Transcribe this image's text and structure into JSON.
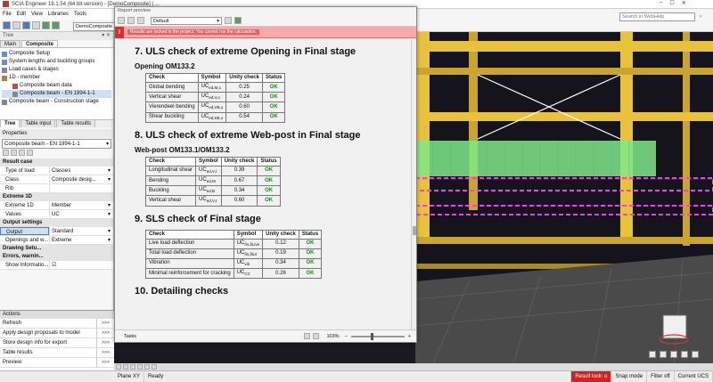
{
  "app": {
    "title": "SCIA Engineer 18.1.54 (64 bit version) - [DemoComposite] | ...",
    "menu": [
      "File",
      "Edit",
      "View",
      "Libraries",
      "Tools"
    ],
    "project_tab": "DemoComposite"
  },
  "search": {
    "placeholder": "Search in WebHelp"
  },
  "tree_panel": {
    "header": "Tree",
    "tabs": [
      "Main",
      "Composite"
    ],
    "items": [
      "Composite Setup",
      "System lengths and buckling groups",
      "Load cases & stages",
      "1D - member",
      "Composite beam data",
      "Composite beam - EN 1994-1-1",
      "Composite beam - Construction stage"
    ],
    "bottom_tabs": [
      "Tree",
      "Table input",
      "Table results"
    ]
  },
  "properties": {
    "header": "Properties",
    "selected": "Composite beam - EN 1994-1-1",
    "groups": [
      {
        "name": "Result case",
        "rows": [
          {
            "key": "Type of load",
            "value": "Classes"
          },
          {
            "key": "Class",
            "value": "Composite desig..."
          },
          {
            "key": "Rib",
            "value": ""
          }
        ]
      },
      {
        "name": "Extreme 1D",
        "rows": [
          {
            "key": "Extreme 1D",
            "value": "Member"
          },
          {
            "key": "Values",
            "value": "UC"
          }
        ]
      },
      {
        "name": "Output settings",
        "rows": [
          {
            "key": "Output",
            "value": "Standard"
          },
          {
            "key": "Openings and w...",
            "value": "Extreme"
          }
        ]
      },
      {
        "name": "Drawing Setu...",
        "rows": []
      },
      {
        "name": "Errors, warnin...",
        "rows": [
          {
            "key": "Show Informatio...",
            "value": ""
          }
        ]
      }
    ]
  },
  "actions": {
    "header": "Actions",
    "items": [
      "Refresh",
      "Apply design proposals to model",
      "Store design info for export",
      "Table results",
      "Preview"
    ],
    "button": ">>>"
  },
  "report": {
    "window_title": "Report preview",
    "style": "Default",
    "warning": "Results are locked in the project. You cannot run the calculation.",
    "sections": [
      {
        "title": "7. ULS check of extreme Opening in Final stage",
        "subtitle": "Opening OM133.2",
        "headers": [
          "Check",
          "Symbol",
          "Unity check",
          "Status"
        ],
        "rows": [
          [
            "Global bending",
            "UC",
            "ed,M,o",
            "0.25",
            "OK"
          ],
          [
            "Vertical shear",
            "UC",
            "ed,V,o",
            "0.24",
            "OK"
          ],
          [
            "Vierendeel bending",
            "UC",
            "ed,VB,o",
            "0.60",
            "OK"
          ],
          [
            "Shear buckling",
            "UC",
            "ed,SB,o",
            "0.54",
            "OK"
          ]
        ]
      },
      {
        "title": "8. ULS check of extreme Web-post in Final stage",
        "subtitle": "Web-post OM133.1/OM133.2",
        "headers": [
          "Check",
          "Symbol",
          "Unity check",
          "Status"
        ],
        "rows": [
          [
            "Longitudinal shear",
            "UC",
            "ed,V,l",
            "0.39",
            "OK"
          ],
          [
            "Bending",
            "UC",
            "ed,M",
            "0.67",
            "OK"
          ],
          [
            "Buckling",
            "UC",
            "ed,B",
            "0.34",
            "OK"
          ],
          [
            "Vertical shear",
            "UC",
            "ed,V,t",
            "0.60",
            "OK"
          ]
        ]
      },
      {
        "title": "9. SLS check of Final stage",
        "subtitle": "",
        "headers": [
          "Check",
          "Symbol",
          "Unity check",
          "Status"
        ],
        "rows": [
          [
            "Live load deflection",
            "UC",
            "fin,δLive",
            "0.12",
            "OK"
          ],
          [
            "Total load deflection",
            "UC",
            "fin,δtot",
            "0.19",
            "OK"
          ],
          [
            "Vibration",
            "UC",
            "vib",
            "0.34",
            "OK"
          ],
          [
            "Minimal reinforcement for cracking",
            "UC",
            "CC",
            "0.26",
            "OK"
          ]
        ]
      },
      {
        "title": "10. Detailing checks",
        "subtitle": "",
        "headers": [],
        "rows": []
      }
    ],
    "status": {
      "tasks": "Tasks",
      "zoom": "103%"
    }
  },
  "statusbar": {
    "plane": "Plane XY",
    "ready": "Ready",
    "result_lock": "Result lock: o",
    "snap": "Snap mode",
    "filter": "Filter off",
    "ucs": "Current UCS"
  },
  "colors": {
    "accent": "#4a7cc0",
    "ok": "#1c8c1c",
    "warning": "#d83030",
    "beams": "#e8c23c",
    "slab": "#7fe88a"
  }
}
